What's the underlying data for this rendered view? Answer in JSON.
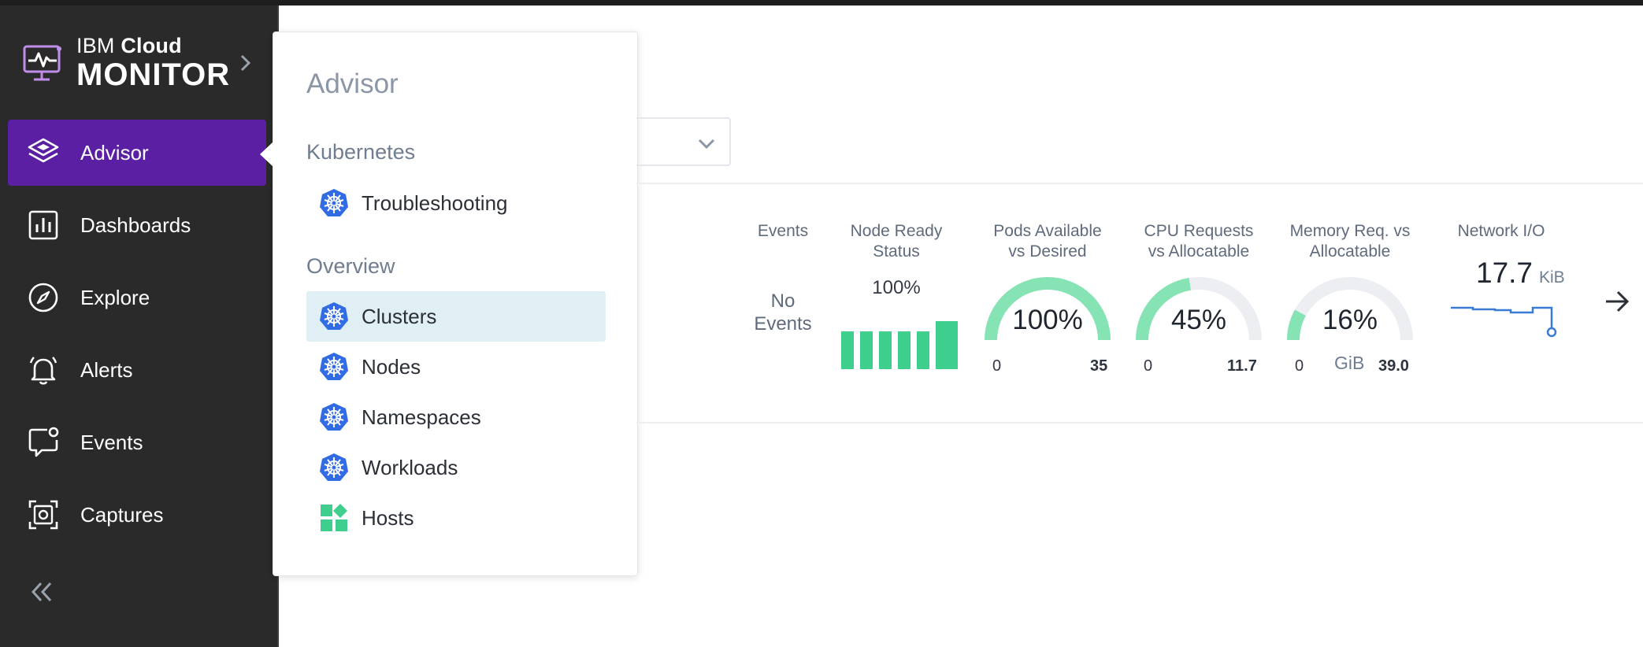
{
  "brand": {
    "line1_regular": "IBM ",
    "line1_bold": "Cloud",
    "line2": "MONITOR"
  },
  "sidebar": {
    "items": [
      {
        "label": "Advisor",
        "icon": "layers-icon",
        "active": true
      },
      {
        "label": "Dashboards",
        "icon": "bar-chart-icon"
      },
      {
        "label": "Explore",
        "icon": "compass-icon"
      },
      {
        "label": "Alerts",
        "icon": "bell-icon"
      },
      {
        "label": "Events",
        "icon": "chat-bubble-icon"
      },
      {
        "label": "Captures",
        "icon": "capture-icon"
      }
    ],
    "collapse_icon": "double-chevron-left-icon"
  },
  "popover": {
    "title": "Advisor",
    "sections": [
      {
        "label": "Kubernetes",
        "items": [
          {
            "label": "Troubleshooting",
            "icon": "kubernetes-icon"
          }
        ]
      },
      {
        "label": "Overview",
        "items": [
          {
            "label": "Clusters",
            "icon": "kubernetes-icon",
            "selected": true
          },
          {
            "label": "Nodes",
            "icon": "kubernetes-icon"
          },
          {
            "label": "Namespaces",
            "icon": "kubernetes-icon"
          },
          {
            "label": "Workloads",
            "icon": "kubernetes-icon"
          },
          {
            "label": "Hosts",
            "icon": "hosts-icon"
          }
        ]
      }
    ]
  },
  "metrics": {
    "events": {
      "label": "Events",
      "value_line1": "No",
      "value_line2": "Events"
    },
    "node_ready": {
      "label_line1": "Node Ready",
      "label_line2": "Status",
      "value": "100%"
    },
    "pods": {
      "label_line1": "Pods Available",
      "label_line2": "vs Desired",
      "value": "100%",
      "fraction": 1.0,
      "min": "0",
      "max": "35"
    },
    "cpu": {
      "label_line1": "CPU Requests",
      "label_line2": "vs Allocatable",
      "value": "45%",
      "fraction": 0.45,
      "min": "0",
      "max": "11.7"
    },
    "memory": {
      "label_line1": "Memory Req. vs",
      "label_line2": "Allocatable",
      "value": "16%",
      "fraction": 0.16,
      "min": "0",
      "unit": "GiB",
      "max": "39.0"
    },
    "network": {
      "label": "Network I/O",
      "value": "17.7",
      "unit": "KiB"
    }
  },
  "colors": {
    "sidebar_bg": "#2a2a2b",
    "active_item": "#5b1fa3",
    "gauge_fill": "#86e3b4",
    "gauge_track": "#eceef1",
    "bar_green": "#3ecf8e",
    "selected_bg": "#dfeff3",
    "kubernetes_blue": "#326ce5",
    "sparkline": "#3a7bd5"
  }
}
